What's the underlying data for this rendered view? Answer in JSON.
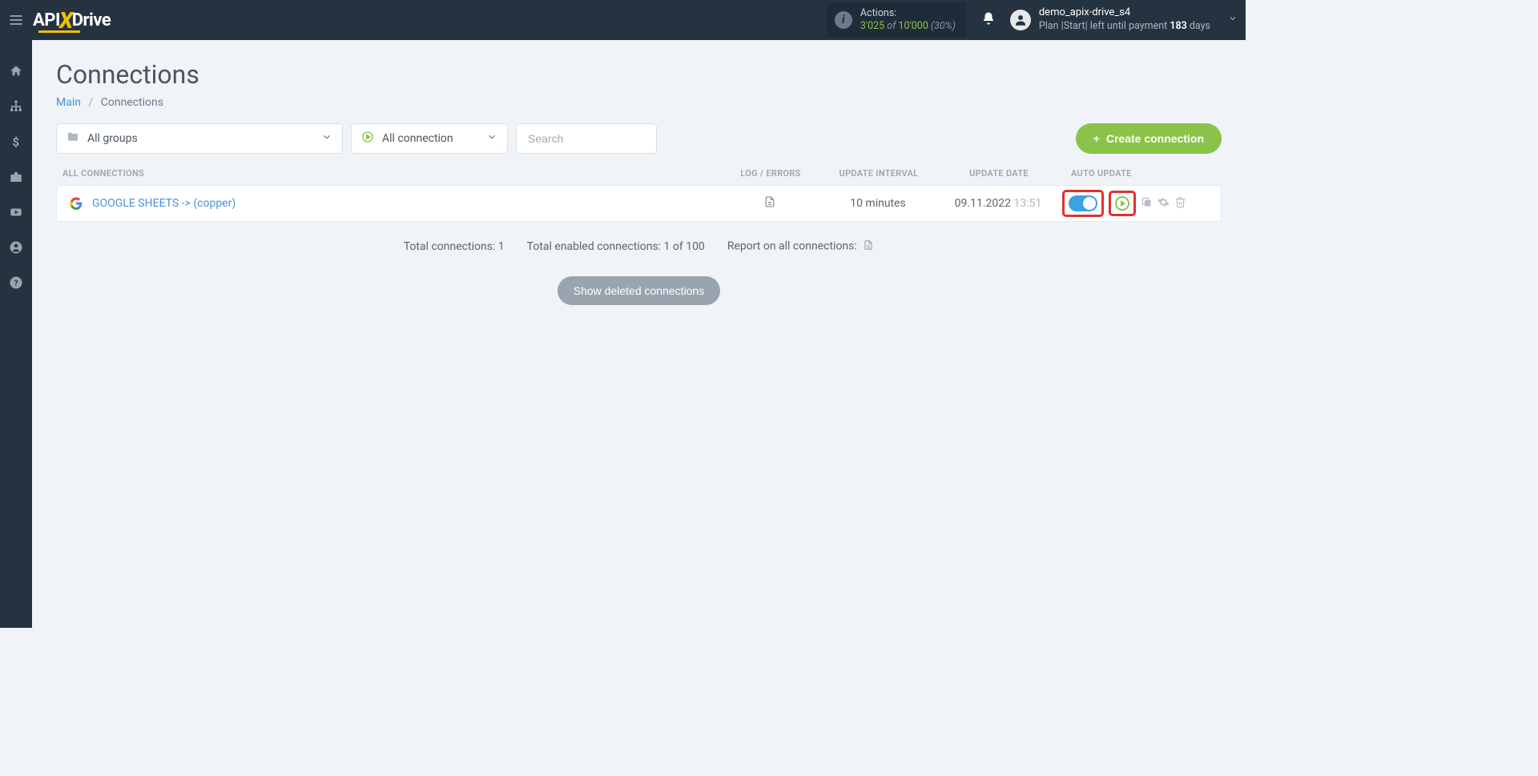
{
  "header": {
    "actions_label": "Actions:",
    "actions_used": "3'025",
    "actions_of": "of",
    "actions_total": "10'000",
    "actions_pct": "(30%)",
    "user_name": "demo_apix-drive_s4",
    "plan_prefix": "Plan |Start|  left until payment",
    "plan_days": "183",
    "plan_days_label": "days"
  },
  "page": {
    "title": "Connections",
    "breadcrumb_main": "Main",
    "breadcrumb_current": "Connections"
  },
  "filters": {
    "groups_label": "All groups",
    "status_label": "All connection",
    "search_placeholder": "Search",
    "create_label": "Create connection"
  },
  "table": {
    "h_name": "ALL CONNECTIONS",
    "h_log": "LOG / ERRORS",
    "h_interval": "UPDATE INTERVAL",
    "h_date": "UPDATE DATE",
    "h_auto": "AUTO UPDATE"
  },
  "row": {
    "name": "GOOGLE SHEETS -> (copper)",
    "interval": "10 minutes",
    "date": "09.11.2022",
    "time": "13:51"
  },
  "summary": {
    "total": "Total connections: 1",
    "enabled": "Total enabled connections: 1 of 100",
    "report": "Report on all connections:"
  },
  "buttons": {
    "show_deleted": "Show deleted connections"
  }
}
